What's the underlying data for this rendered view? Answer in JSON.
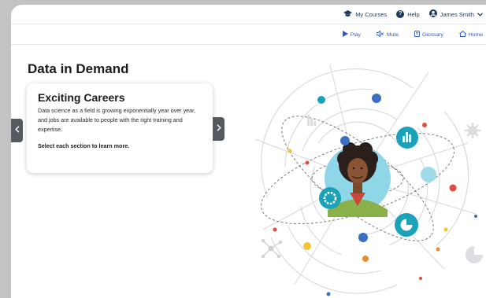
{
  "topbar": {
    "my_courses": "My Courses",
    "help": "Help",
    "user": "James Smith"
  },
  "navbar": {
    "play": "Play",
    "mute": "Mute",
    "glossary": "Glossary",
    "home": "Home"
  },
  "page": {
    "title": "Data in Demand"
  },
  "card": {
    "title": "Exciting Careers",
    "body": "Data science as a field is growing exponentially year over year, and jobs are available to people with the right training and expertise.",
    "cta": "Select each section to learn more."
  },
  "icons": {
    "mortarboard": "mortarboard-icon",
    "help": "help-icon",
    "user": "user-icon",
    "play": "play-icon",
    "mute": "speaker-icon",
    "glossary": "book-icon",
    "home": "home-icon"
  },
  "colors": {
    "nav_text": "#2b57c9",
    "top_text": "#1f3a5f",
    "accent_teal": "#1aa3b8",
    "accent_blue": "#3a6fc0",
    "accent_yellow": "#f3c333",
    "accent_red": "#e04b3b",
    "accent_orange": "#f08a2a",
    "light_blue": "#8fd6e8"
  }
}
